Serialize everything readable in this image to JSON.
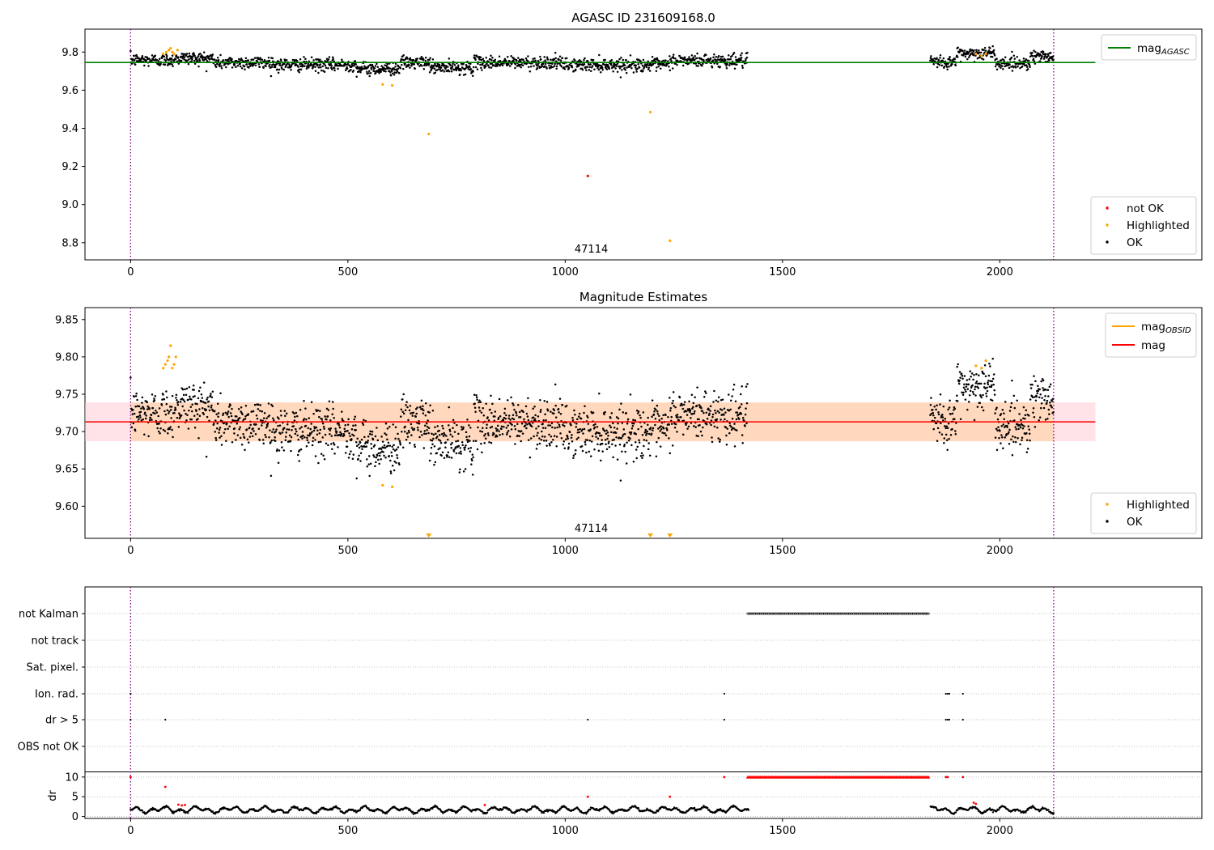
{
  "chart_data": [
    {
      "type": "scatter",
      "title": "AGASC ID 231609168.0",
      "xlim": [
        -105,
        2465
      ],
      "ylim": [
        8.71,
        9.92
      ],
      "xticks": [
        0,
        500,
        1000,
        1500,
        2000
      ],
      "yticks": [
        8.8,
        9.0,
        9.2,
        9.4,
        9.6,
        9.8
      ],
      "ytick_labels": [
        "8.8",
        "9.0",
        "9.2",
        "9.4",
        "9.6",
        "9.8"
      ],
      "obsid_label": "47114",
      "obsid_label_x": 1060,
      "vlines": [
        0,
        2124
      ],
      "hline": {
        "name": "mag",
        "sub": "AGASC",
        "value": 9.745,
        "xrange": [
          -105,
          2220
        ],
        "color": "#008000"
      },
      "series": [
        {
          "name": "not OK",
          "color": "#ff0000",
          "points": [
            [
              1052,
              9.15
            ]
          ]
        },
        {
          "name": "Highlighted",
          "color": "#ffa500",
          "points": [
            [
              75,
              9.79
            ],
            [
              82,
              9.8
            ],
            [
              88,
              9.81
            ],
            [
              92,
              9.82
            ],
            [
              96,
              9.8
            ],
            [
              100,
              9.79
            ],
            [
              108,
              9.81
            ],
            [
              580,
              9.63
            ],
            [
              602,
              9.625
            ],
            [
              686,
              9.37
            ],
            [
              1196,
              9.485
            ],
            [
              1241,
              8.81
            ],
            [
              1945,
              9.79
            ],
            [
              1958,
              9.78
            ],
            [
              1968,
              9.79
            ]
          ]
        },
        {
          "name": "OK",
          "color": "#000000",
          "generator": "agasc_ok"
        }
      ],
      "legend_lines": [
        {
          "name": "mag",
          "sub": "AGASC",
          "color": "#008000"
        }
      ],
      "legend_points": [
        {
          "name": "not OK",
          "color": "#ff0000"
        },
        {
          "name": "Highlighted",
          "color": "#ffa500"
        },
        {
          "name": "OK",
          "color": "#000000"
        }
      ]
    },
    {
      "type": "scatter",
      "title": "Magnitude Estimates",
      "xlim": [
        -105,
        2465
      ],
      "ylim": [
        9.557,
        9.866
      ],
      "xticks": [
        0,
        500,
        1000,
        1500,
        2000
      ],
      "yticks": [
        9.6,
        9.65,
        9.7,
        9.75,
        9.8,
        9.85
      ],
      "ytick_labels": [
        "9.60",
        "9.65",
        "9.70",
        "9.75",
        "9.80",
        "9.85"
      ],
      "obsid_label": "47114",
      "obsid_label_x": 1060,
      "vlines": [
        0,
        2124
      ],
      "mag": {
        "name": "mag",
        "value": 9.713,
        "xrange": [
          -105,
          2220
        ],
        "color": "#ff0000"
      },
      "mag_band": {
        "low": 9.687,
        "high": 9.739,
        "xrange": [
          -105,
          2220
        ],
        "color": "#ffc0cb"
      },
      "obsid_band": {
        "low": 9.687,
        "high": 9.739,
        "xrange": [
          0,
          2124
        ],
        "color": "#ffa500"
      },
      "series": [
        {
          "name": "Highlighted",
          "color": "#ffa500",
          "points": [
            [
              75,
              9.785
            ],
            [
              80,
              9.79
            ],
            [
              85,
              9.795
            ],
            [
              88,
              9.8
            ],
            [
              92,
              9.815
            ],
            [
              96,
              9.785
            ],
            [
              100,
              9.79
            ],
            [
              104,
              9.8
            ],
            [
              580,
              9.628
            ],
            [
              602,
              9.626
            ],
            [
              1945,
              9.788
            ],
            [
              1958,
              9.785
            ],
            [
              1968,
              9.795
            ]
          ]
        },
        {
          "name": "Highlighted (below axis)",
          "color": "#ffa500",
          "points": [
            [
              686,
              9.56
            ],
            [
              1196,
              9.56
            ],
            [
              1241,
              9.56
            ]
          ]
        },
        {
          "name": "OK",
          "color": "#000000",
          "generator": "mag_ok"
        }
      ],
      "legend_lines": [
        {
          "name": "mag",
          "sub": "OBSID",
          "color": "#ffa500"
        },
        {
          "name": "mag",
          "sub": "",
          "color": "#ff0000"
        }
      ],
      "legend_points": [
        {
          "name": "Highlighted",
          "color": "#ffa500"
        },
        {
          "name": "OK",
          "color": "#000000"
        }
      ]
    },
    {
      "type": "scatter",
      "title": "",
      "xlim": [
        -105,
        2465
      ],
      "xticks": [
        0,
        500,
        1000,
        1500,
        2000
      ],
      "vlines": [
        0,
        2124
      ],
      "flag_rows": [
        "not Kalman",
        "not track",
        "Sat. pixel.",
        "Ion. rad.",
        "dr > 5",
        "OBS not OK"
      ],
      "flag_points": [
        {
          "row": "not Kalman",
          "ranges": [
            [
              1420,
              1838
            ]
          ]
        },
        {
          "row": "Ion. rad.",
          "x": [
            0,
            1366,
            1876,
            1880,
            1884,
            1915
          ]
        },
        {
          "row": "dr > 5",
          "x": [
            0,
            80,
            1052,
            1366,
            1876,
            1880,
            1884,
            1915
          ]
        }
      ],
      "dr_panel": {
        "ylabel": "dr",
        "ylim": [
          -0.5,
          11
        ],
        "yticks": [
          0,
          5,
          10
        ],
        "ytick_labels": [
          "0",
          "5",
          "10"
        ],
        "red_points": [
          [
            0,
            10
          ],
          [
            80,
            7.5
          ],
          [
            110,
            3
          ],
          [
            118,
            2.8
          ],
          [
            125,
            2.9
          ],
          [
            815,
            2.9
          ],
          [
            1052,
            5
          ],
          [
            1241,
            5
          ],
          [
            1366,
            10
          ],
          [
            1876,
            10
          ],
          [
            1880,
            10
          ],
          [
            1915,
            10
          ],
          [
            1940,
            3.5
          ],
          [
            1945,
            3.2
          ]
        ],
        "red_ranges": [
          [
            1420,
            1838,
            10
          ]
        ],
        "gaps": [
          [
            1422,
            1840
          ]
        ]
      }
    }
  ]
}
